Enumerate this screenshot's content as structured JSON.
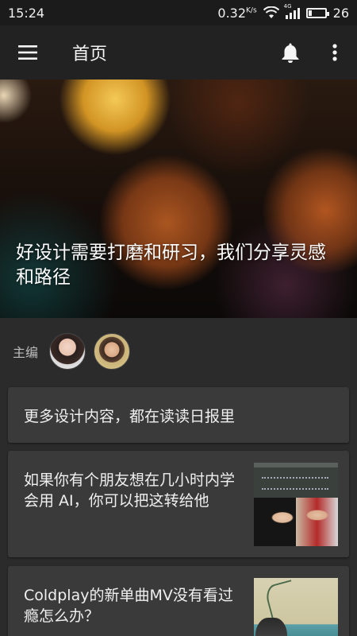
{
  "status_bar": {
    "time": "15:24",
    "net_speed": "0.32",
    "net_speed_unit": "K/s",
    "network": "4G",
    "battery": "26"
  },
  "app_bar": {
    "title": "首页",
    "icons": [
      "menu-icon",
      "bell-icon",
      "more-vert-icon"
    ]
  },
  "hero": {
    "title": "好设计需要打磨和研习，我们分享灵感和路径"
  },
  "editors": {
    "label": "主编"
  },
  "cards": [
    {
      "title": "更多设计内容，都在读读日报里"
    },
    {
      "title": "如果你有个朋友想在几小时内学会用 AI，你可以把这转给他"
    },
    {
      "title": "Coldplay的新单曲MV没有看过瘾怎么办？"
    }
  ],
  "colors": {
    "background": "#2b2b2b",
    "app_bar": "#222222",
    "card": "#3a3a3a",
    "text": "#f0f0f0"
  }
}
